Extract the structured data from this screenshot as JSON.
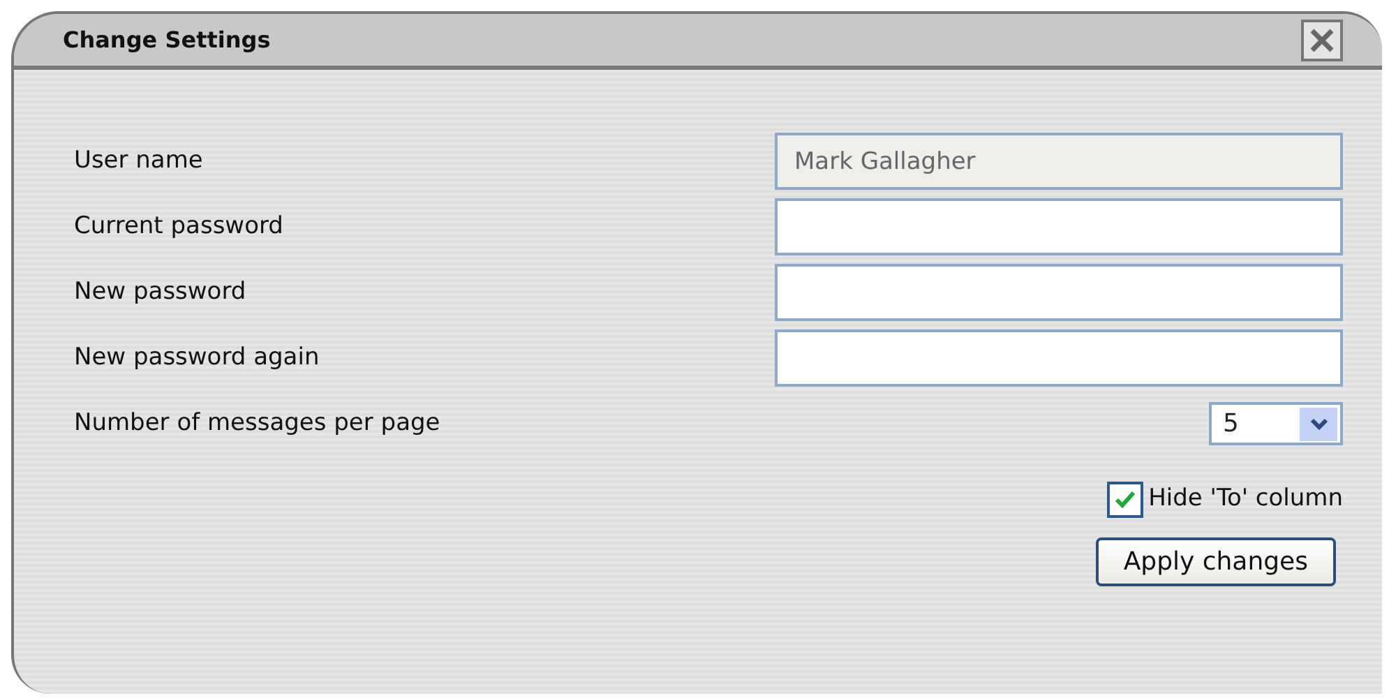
{
  "window": {
    "title": "Change Settings"
  },
  "fields": [
    {
      "label": "User name",
      "kind": "text",
      "value": "Mark Gallagher",
      "disabled": true
    },
    {
      "label": "Current password",
      "kind": "password",
      "disabled": false
    },
    {
      "label": "New password",
      "kind": "password",
      "disabled": false
    },
    {
      "label": "New password again",
      "kind": "password",
      "disabled": false
    }
  ],
  "messages_per_page": {
    "label": "Number of messages per page",
    "value": "5"
  },
  "hide_to_column": {
    "label": "Hide 'To' column",
    "checked": true
  },
  "buttons": [
    "Apply changes"
  ]
}
